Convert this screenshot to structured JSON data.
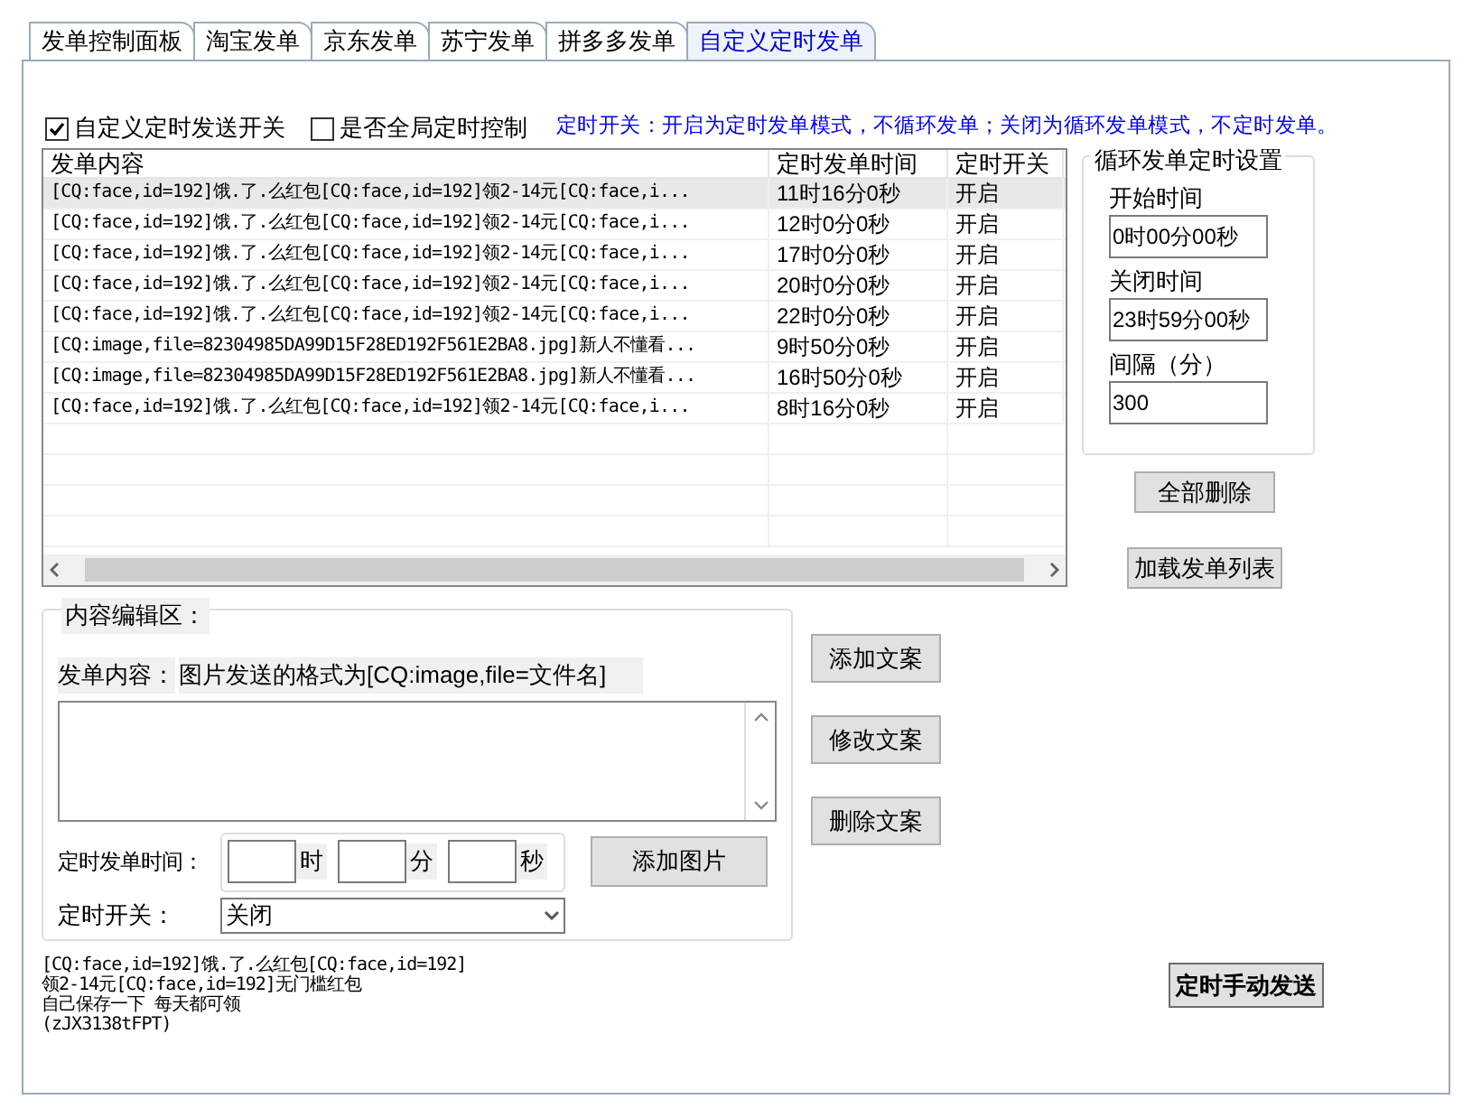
{
  "tabs": [
    {
      "label": "发单控制面板",
      "selected": false
    },
    {
      "label": "淘宝发单",
      "selected": false
    },
    {
      "label": "京东发单",
      "selected": false
    },
    {
      "label": "苏宁发单",
      "selected": false
    },
    {
      "label": "拼多多发单",
      "selected": false
    },
    {
      "label": "自定义定时发单",
      "selected": true
    }
  ],
  "options": [
    {
      "label": "自定义定时发送开关",
      "checked": true
    },
    {
      "label": "是否全局定时控制",
      "checked": false
    }
  ],
  "hint": "定时开关：开启为定时发单模式，不循环发单；关闭为循环发单模式，不定时发单。",
  "table": {
    "columns": [
      "发单内容",
      "定时发单时间",
      "定时开关"
    ],
    "rows": [
      {
        "cells": [
          "[CQ:face,id=192]饿.了.么红包[CQ:face,id=192]领2-14元[CQ:face,i...",
          "11时16分0秒",
          "开启"
        ],
        "selected": true
      },
      {
        "cells": [
          "[CQ:face,id=192]饿.了.么红包[CQ:face,id=192]领2-14元[CQ:face,i...",
          "12时0分0秒",
          "开启"
        ],
        "selected": false
      },
      {
        "cells": [
          "[CQ:face,id=192]饿.了.么红包[CQ:face,id=192]领2-14元[CQ:face,i...",
          "17时0分0秒",
          "开启"
        ],
        "selected": false
      },
      {
        "cells": [
          "[CQ:face,id=192]饿.了.么红包[CQ:face,id=192]领2-14元[CQ:face,i...",
          "20时0分0秒",
          "开启"
        ],
        "selected": false
      },
      {
        "cells": [
          "[CQ:face,id=192]饿.了.么红包[CQ:face,id=192]领2-14元[CQ:face,i...",
          "22时0分0秒",
          "开启"
        ],
        "selected": false
      },
      {
        "cells": [
          "[CQ:image,file=82304985DA99D15F28ED192F561E2BA8.jpg]新人不懂看...",
          "9时50分0秒",
          "开启"
        ],
        "selected": false
      },
      {
        "cells": [
          "[CQ:image,file=82304985DA99D15F28ED192F561E2BA8.jpg]新人不懂看...",
          "16时50分0秒",
          "开启"
        ],
        "selected": false
      },
      {
        "cells": [
          "[CQ:face,id=192]饿.了.么红包[CQ:face,id=192]领2-14元[CQ:face,i...",
          "8时16分0秒",
          "开启"
        ],
        "selected": false
      }
    ]
  },
  "loop": {
    "title": "循环发单定时设置",
    "fields": [
      {
        "label": "开始时间",
        "value": "0时00分00秒"
      },
      {
        "label": "关闭时间",
        "value": "23时59分00秒"
      },
      {
        "label": "间隔（分）",
        "value": "300"
      }
    ]
  },
  "side_buttons": [
    "全部删除",
    "加载发单列表"
  ],
  "editor": {
    "title": "内容编辑区：",
    "content_label": "发单内容：",
    "content_hint": "图片发送的格式为[CQ:image,file=文件名]",
    "time_label": "定时发单时间：",
    "units": [
      "时",
      "分",
      "秒"
    ],
    "add_image": "添加图片",
    "switch_label": "定时开关：",
    "switch_value": "关闭"
  },
  "edit_buttons": [
    "添加文案",
    "修改文案",
    "删除文案"
  ],
  "log": [
    "[CQ:face,id=192]饿.了.么红包[CQ:face,id=192]",
    "领2-14元[CQ:face,id=192]无门槛红包",
    "自己保存一下 每天都可领",
    "(zJX3138tFPT)"
  ],
  "send_button": "定时手动发送"
}
